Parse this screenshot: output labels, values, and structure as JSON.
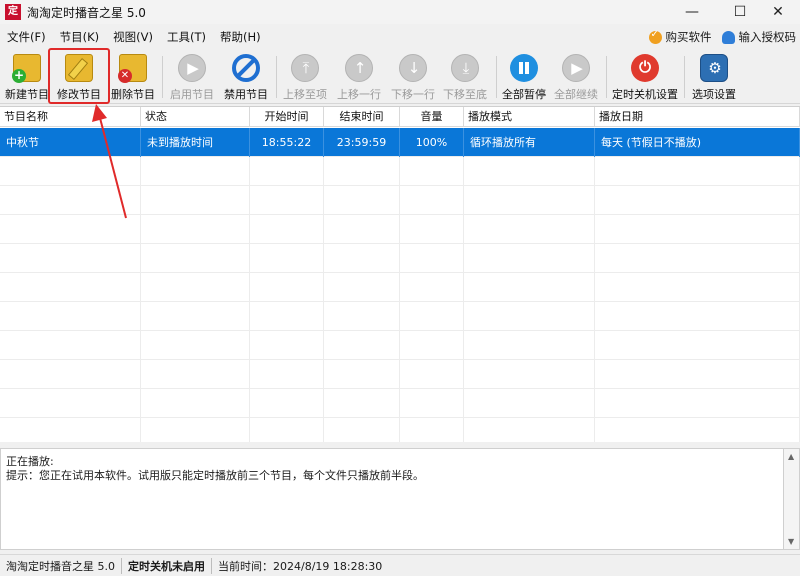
{
  "window": {
    "app_icon_text": "定",
    "title": "淘淘定时播音之星 5.0"
  },
  "menu": {
    "items": [
      "文件(F)",
      "节目(K)",
      "视图(V)",
      "工具(T)",
      "帮助(H)"
    ],
    "buy_label": "购买软件",
    "license_label": "输入授权码"
  },
  "toolbar": {
    "new": "新建节目",
    "edit": "修改节目",
    "delete": "删除节目",
    "enable": "启用节目",
    "disable": "禁用节目",
    "move_top": "上移至项",
    "move_up": "上移一行",
    "move_down": "下移一行",
    "move_bottom": "下移至底",
    "pause_all": "全部暂停",
    "resume_all": "全部继续",
    "shutdown": "定时关机设置",
    "options": "选项设置"
  },
  "table": {
    "columns": [
      "节目名称",
      "状态",
      "开始时间",
      "结束时间",
      "音量",
      "播放模式",
      "播放日期"
    ],
    "rows": [
      [
        "中秋节",
        "未到播放时间",
        "18:55:22",
        "23:59:59",
        "100%",
        "循环播放所有",
        "每天 (节假日不播放)"
      ]
    ]
  },
  "info": {
    "playing": "正在播放:",
    "tip": "提示：您正在试用本软件。试用版只能定时播放前三个节目，每个文件只播放前半段。"
  },
  "status": {
    "app": "淘淘定时播音之星 5.0",
    "shutdown": "定时关机未启用",
    "time": "当前时间：2024/8/19 18:28:30"
  },
  "colors": {
    "selection": "#0a77d8",
    "highlight": "#e02a2a"
  }
}
